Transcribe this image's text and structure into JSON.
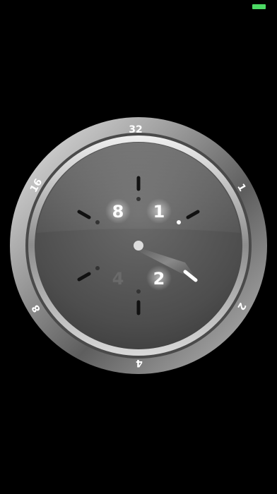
{
  "status_bar": {
    "battery_color": "#4cd964"
  },
  "clock": {
    "bezel_labels": [
      "32",
      "1",
      "2",
      "4",
      "8",
      "16"
    ],
    "face_digits": [
      {
        "id": "one",
        "text": "1",
        "lit": true
      },
      {
        "id": "two",
        "text": "2",
        "lit": true
      },
      {
        "id": "four",
        "text": "4",
        "lit": false
      },
      {
        "id": "eight",
        "text": "8",
        "lit": true
      }
    ],
    "colors": {
      "background": "#000000",
      "lit_digit": "#ffffff",
      "unlit_digit": "#6a6a6a",
      "face_upper": "#5a5a5a",
      "face_lower": "#4a4a4a"
    }
  }
}
